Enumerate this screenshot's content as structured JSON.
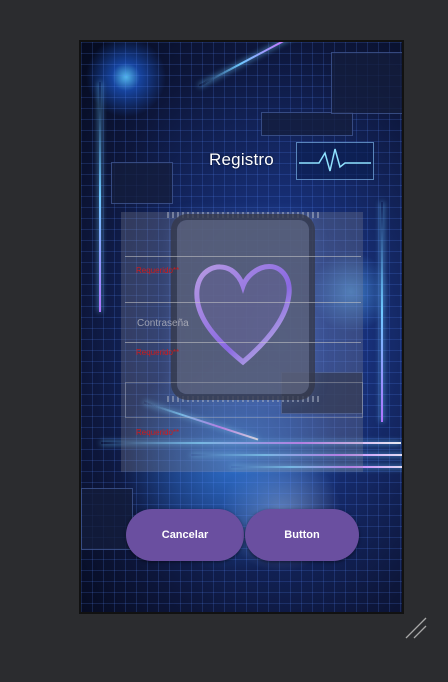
{
  "screen": {
    "title": "Registro"
  },
  "form": {
    "fields": [
      {
        "hint": "",
        "error": "Requerido**"
      },
      {
        "hint": "Contraseña",
        "error": "Requerido**"
      },
      {
        "hint": "",
        "error": "Requerido**"
      }
    ]
  },
  "buttons": {
    "cancel_label": "Cancelar",
    "submit_label": "Button"
  },
  "colors": {
    "button": "#6a4fa0",
    "error": "#d11a1a",
    "editor_background": "#2b2c2f"
  },
  "icons": {
    "resize": "resize-handle-icon"
  }
}
